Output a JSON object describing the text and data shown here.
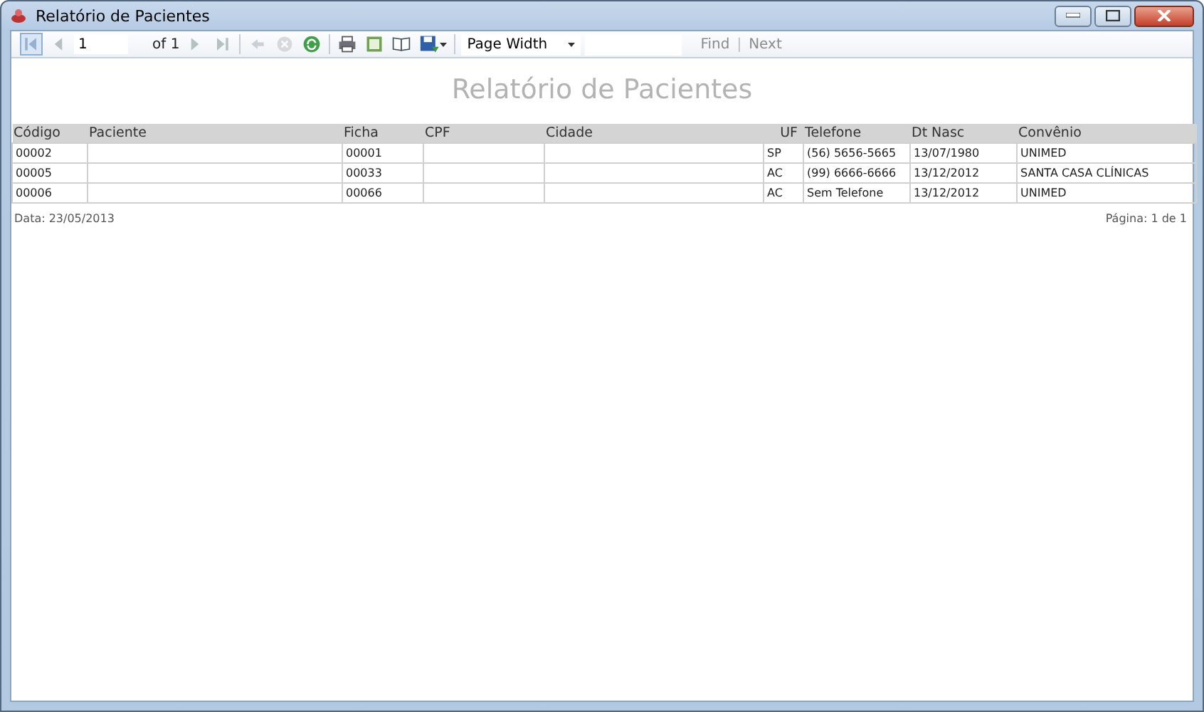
{
  "window": {
    "title": "Relatório de Pacientes"
  },
  "toolbar": {
    "groups": [
      [
        {
          "kind": "icon-button",
          "disabled": true,
          "selected": true
        },
        {
          "kind": "icon-button",
          "disabled": true,
          "selected": false
        },
        {
          "kind": "page-input",
          "value": "1"
        },
        {
          "kind": "label",
          "text": "of 1"
        },
        {
          "kind": "icon-button",
          "disabled": true,
          "selected": false
        },
        {
          "kind": "icon-button",
          "disabled": true,
          "selected": false
        }
      ],
      [
        {
          "kind": "icon-button",
          "disabled": true,
          "selected": false
        },
        {
          "kind": "icon-button",
          "disabled": true,
          "selected": false
        },
        {
          "kind": "icon-button",
          "disabled": false,
          "selected": false
        }
      ],
      [
        {
          "kind": "icon-button",
          "disabled": false,
          "selected": false
        },
        {
          "kind": "icon-button",
          "disabled": false,
          "selected": false
        },
        {
          "kind": "icon-button",
          "disabled": false,
          "selected": false
        },
        {
          "kind": "icon-button",
          "disabled": false,
          "selected": false
        }
      ],
      [
        {
          "kind": "select",
          "value": "Page Width"
        },
        {
          "kind": "find-field"
        },
        {
          "kind": "text-button",
          "text": "Find",
          "disabled": true
        },
        {
          "kind": "label",
          "text": "|"
        },
        {
          "kind": "text-button",
          "text": "Next",
          "disabled": true
        }
      ]
    ]
  },
  "report": {
    "title": "Relatório de Pacientes",
    "table": {
      "columns": [
        "Código",
        "Paciente",
        "Ficha",
        "CPF",
        "Cidade",
        "UF",
        "Telefone",
        "Dt Nasc",
        "Convênio"
      ],
      "rows": [
        [
          "00002",
          "",
          "00001",
          "",
          "",
          "SP",
          "(56) 5656-5665",
          "13/07/1980",
          "UNIMED"
        ],
        [
          "00005",
          "",
          "00033",
          "",
          "",
          "AC",
          "(99) 6666-6666",
          "13/12/2012",
          "SANTA CASA CLÍNICAS"
        ],
        [
          "00006",
          "",
          "00066",
          "",
          "",
          "AC",
          "Sem Telefone",
          "13/12/2012",
          "UNIMED"
        ]
      ]
    },
    "footer_left": "Data: 23/05/2013",
    "footer_right": "Página: 1 de 1"
  }
}
